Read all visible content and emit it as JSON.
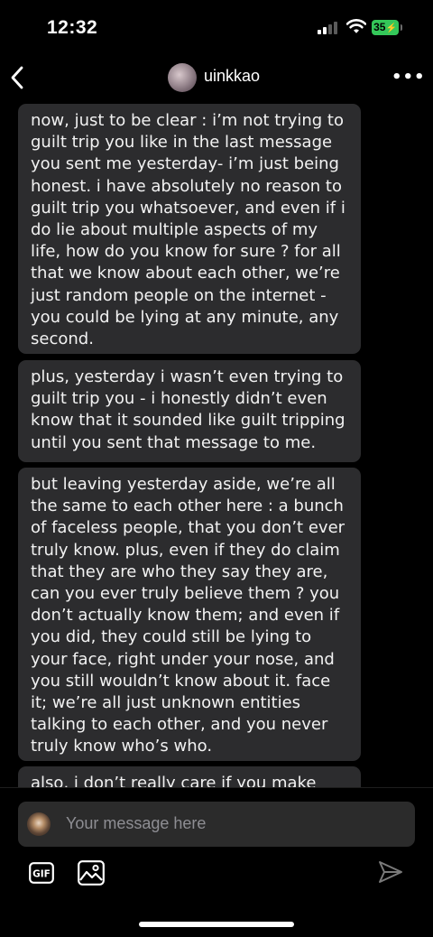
{
  "status_bar": {
    "time": "12:32",
    "battery": "35"
  },
  "header": {
    "username": "uinkkao",
    "more_label": "•••"
  },
  "messages": [
    {
      "text": "now, just to be clear : i’m not trying to guilt trip you like in the last message you sent me yesterday- i’m just being honest. i have absolutely no reason to guilt trip you whatsoever, and even if i do lie about multiple aspects of my life, how do you know for sure ? for all that we know about each other, we’re just random people on the internet - you could be lying at any minute, any second."
    },
    {
      "text": "plus, yesterday i wasn’t even trying to guilt trip you - i honestly didn’t even know that it sounded like guilt tripping until you sent that message to me."
    },
    {
      "text": "but leaving yesterday aside, we’re all the same to each other here : a bunch of faceless people, that you don’t ever truly know. plus, even if they do claim that they are who they say they are, can you ever truly believe them ? you don’t actually know them; and even if you did, they could still be lying to your face, right under your nose, and you still wouldn’t know about it. face it; we’re all just unknown entities talking to each other, and you never truly know who’s who."
    },
    {
      "text": "also, i don’t really care if you make this"
    }
  ],
  "composer": {
    "placeholder": "Your message here",
    "gif_label": "GIF"
  },
  "colors": {
    "background": "#000000",
    "bubble": "#2c2c2e",
    "composer": "#2b2b2b",
    "battery": "#34c759",
    "placeholder": "#8e8e93"
  },
  "icons": {
    "back": "chevron-left-icon",
    "more": "ellipsis-icon",
    "gif": "gif-icon",
    "image": "image-icon",
    "send": "send-icon",
    "wifi": "wifi-icon",
    "signal": "signal-icon",
    "battery": "battery-icon"
  }
}
